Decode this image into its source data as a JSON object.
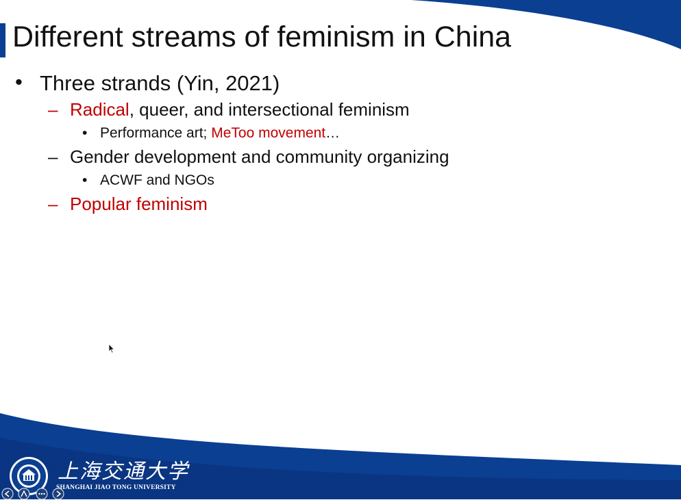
{
  "slide": {
    "title": "Different streams of feminism in China",
    "bullet_glyph": "•",
    "dash_glyph": "–",
    "level1": {
      "text": "Three strands (Yin, 2021)"
    },
    "item1": {
      "highlight": "Radical",
      "rest": ", queer, and intersectional feminism",
      "sub_prefix": "Performance art; ",
      "sub_highlight": "MeToo movement",
      "sub_suffix": "…"
    },
    "item2": {
      "text": "Gender development and community organizing",
      "sub": "ACWF and NGOs"
    },
    "item3": {
      "text": "Popular feminism"
    }
  },
  "footer": {
    "university_cn": "上海交通大学",
    "university_en": "SHANGHAI JIAO TONG UNIVERSITY"
  },
  "controls": {
    "prev_icon": "arrow-left-icon",
    "pen_icon": "pen-icon",
    "menu_icon": "more-options-icon",
    "next_icon": "arrow-right-icon"
  },
  "colors": {
    "accent_blue": "#0b3f92",
    "highlight_red": "#c00000",
    "text": "#111111"
  }
}
